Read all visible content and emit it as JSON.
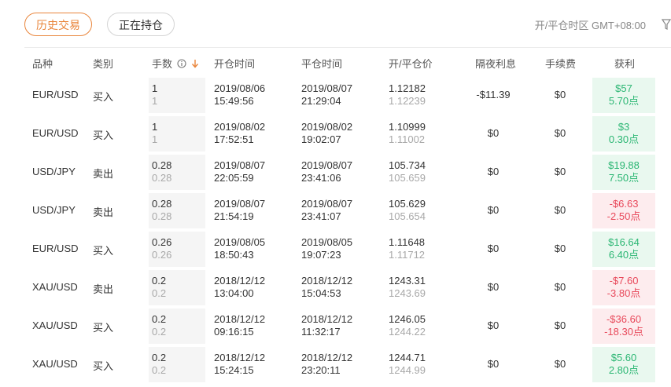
{
  "tabs": {
    "history": "历史交易",
    "open": "正在持仓"
  },
  "timezone": "开/平仓时区 GMT+08:00",
  "headers": {
    "symbol": "品种",
    "type": "类别",
    "lots": "手数",
    "open_time": "开仓时间",
    "close_time": "平仓时间",
    "price": "开/平仓价",
    "swap": "隔夜利息",
    "fee": "手续费",
    "profit": "获利"
  },
  "rows": [
    {
      "symbol": "EUR/USD",
      "type": "买入",
      "lots": "1",
      "lots_sub": "1",
      "open_date": "2019/08/06",
      "open_time": "15:49:56",
      "close_date": "2019/08/07",
      "close_time": "21:29:04",
      "open_price": "1.12182",
      "close_price": "1.12239",
      "swap": "-$11.39",
      "fee": "$0",
      "profit": "$57",
      "points": "5.70点",
      "sign": "pos"
    },
    {
      "symbol": "EUR/USD",
      "type": "买入",
      "lots": "1",
      "lots_sub": "1",
      "open_date": "2019/08/02",
      "open_time": "17:52:51",
      "close_date": "2019/08/02",
      "close_time": "19:02:07",
      "open_price": "1.10999",
      "close_price": "1.11002",
      "swap": "$0",
      "fee": "$0",
      "profit": "$3",
      "points": "0.30点",
      "sign": "pos"
    },
    {
      "symbol": "USD/JPY",
      "type": "卖出",
      "lots": "0.28",
      "lots_sub": "0.28",
      "open_date": "2019/08/07",
      "open_time": "22:05:59",
      "close_date": "2019/08/07",
      "close_time": "23:41:06",
      "open_price": "105.734",
      "close_price": "105.659",
      "swap": "$0",
      "fee": "$0",
      "profit": "$19.88",
      "points": "7.50点",
      "sign": "pos"
    },
    {
      "symbol": "USD/JPY",
      "type": "卖出",
      "lots": "0.28",
      "lots_sub": "0.28",
      "open_date": "2019/08/07",
      "open_time": "21:54:19",
      "close_date": "2019/08/07",
      "close_time": "23:41:07",
      "open_price": "105.629",
      "close_price": "105.654",
      "swap": "$0",
      "fee": "$0",
      "profit": "-$6.63",
      "points": "-2.50点",
      "sign": "neg"
    },
    {
      "symbol": "EUR/USD",
      "type": "买入",
      "lots": "0.26",
      "lots_sub": "0.26",
      "open_date": "2019/08/05",
      "open_time": "18:50:43",
      "close_date": "2019/08/05",
      "close_time": "19:07:23",
      "open_price": "1.11648",
      "close_price": "1.11712",
      "swap": "$0",
      "fee": "$0",
      "profit": "$16.64",
      "points": "6.40点",
      "sign": "pos"
    },
    {
      "symbol": "XAU/USD",
      "type": "卖出",
      "lots": "0.2",
      "lots_sub": "0.2",
      "open_date": "2018/12/12",
      "open_time": "13:04:00",
      "close_date": "2018/12/12",
      "close_time": "15:04:53",
      "open_price": "1243.31",
      "close_price": "1243.69",
      "swap": "$0",
      "fee": "$0",
      "profit": "-$7.60",
      "points": "-3.80点",
      "sign": "neg"
    },
    {
      "symbol": "XAU/USD",
      "type": "买入",
      "lots": "0.2",
      "lots_sub": "0.2",
      "open_date": "2018/12/12",
      "open_time": "09:16:15",
      "close_date": "2018/12/12",
      "close_time": "11:32:17",
      "open_price": "1246.05",
      "close_price": "1244.22",
      "swap": "$0",
      "fee": "$0",
      "profit": "-$36.60",
      "points": "-18.30点",
      "sign": "neg"
    },
    {
      "symbol": "XAU/USD",
      "type": "买入",
      "lots": "0.2",
      "lots_sub": "0.2",
      "open_date": "2018/12/12",
      "open_time": "15:24:15",
      "close_date": "2018/12/12",
      "close_time": "23:20:11",
      "open_price": "1244.71",
      "close_price": "1244.99",
      "swap": "$0",
      "fee": "$0",
      "profit": "$5.60",
      "points": "2.80点",
      "sign": "pos"
    }
  ],
  "colors": {
    "accent": "#e9853b",
    "positive": "#2bb673",
    "negative": "#e8485a"
  }
}
